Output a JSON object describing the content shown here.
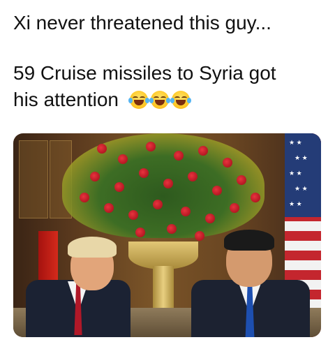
{
  "post": {
    "line1": "Xi never threatened this guy...",
    "line2": "59 Cruise missiles to Syria got",
    "line3": "his attention",
    "emoji": [
      "face-with-tears-of-joy",
      "face-with-tears-of-joy",
      "face-with-tears-of-joy"
    ]
  },
  "photo": {
    "subject": "two men in suits seated before a large floral arrangement of red roses and yellow flowers in a gold vase"
  },
  "colors": {
    "text": "#111111",
    "rose": "#c8101c",
    "flag_red": "#c4262e",
    "flag_blue": "#243c77"
  }
}
